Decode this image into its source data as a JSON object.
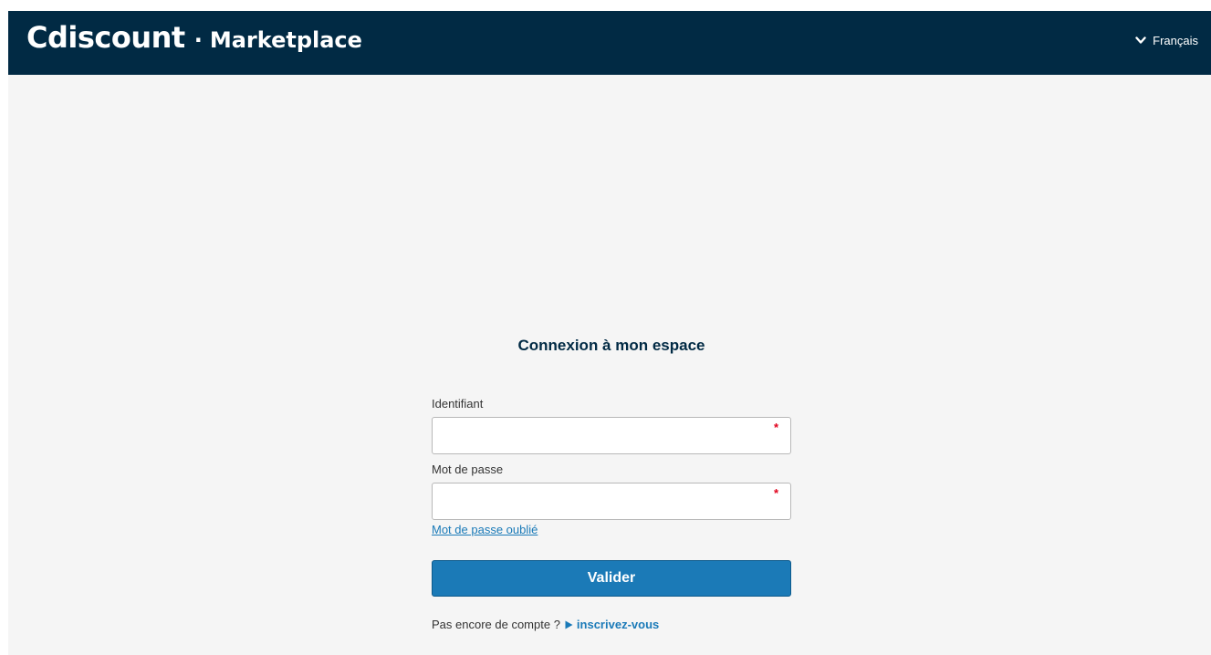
{
  "header": {
    "brand_main": "Cdiscount",
    "brand_separator": "·",
    "brand_sub": "Marketplace",
    "language": "Français",
    "language_icon": "chevron-down-icon"
  },
  "login": {
    "title": "Connexion à mon espace",
    "username_label": "Identifiant",
    "username_value": "",
    "password_label": "Mot de passe",
    "password_value": "",
    "required_marker": "*",
    "forgot_password": "Mot de passe oublié",
    "submit_label": "Valider",
    "signup_prompt": "Pas encore de compte ?",
    "signup_icon": "play-arrow-icon",
    "signup_link": "inscrivez-vous"
  },
  "colors": {
    "header_background": "#012a44",
    "page_background": "#f5f5f5",
    "accent": "#1b7ab7",
    "link": "#1a7ab8",
    "required": "#e1001b"
  }
}
